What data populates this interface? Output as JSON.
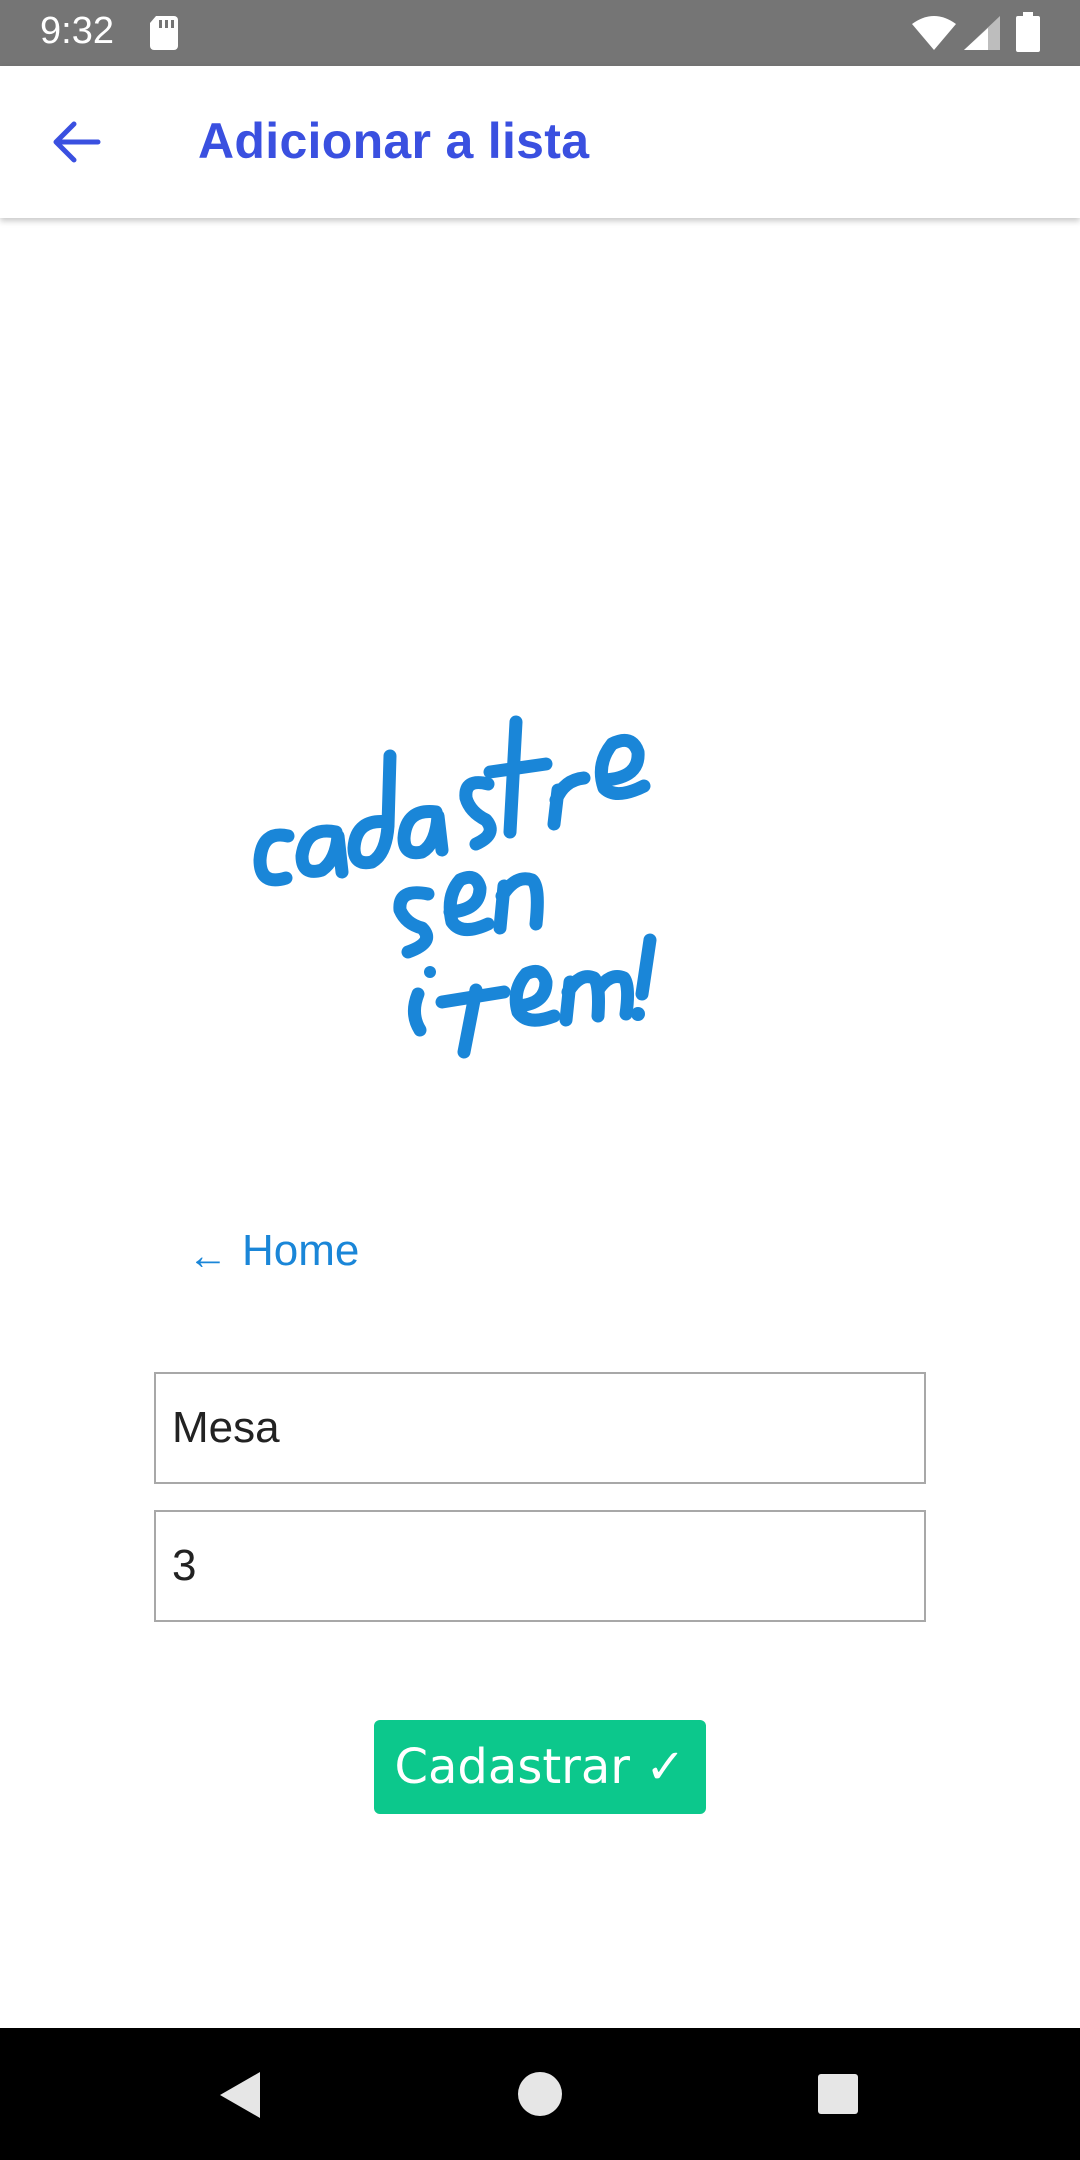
{
  "status_bar": {
    "time": "9:32",
    "icons": [
      "sd-card-icon",
      "wifi-icon",
      "signal-icon",
      "battery-icon"
    ]
  },
  "app_bar": {
    "title": "Adicionar a lista",
    "back_icon": "arrow-left-icon"
  },
  "hero": {
    "lettering": "cadastre seu item!",
    "color": "#1a86d8"
  },
  "home_link": {
    "arrow": "←",
    "label": "Home"
  },
  "form": {
    "name_value": "Mesa",
    "quantity_value": "3",
    "submit_label": "Cadastrar ✓"
  },
  "nav_bar": {
    "icons": [
      "back-triangle-icon",
      "home-circle-icon",
      "recents-square-icon"
    ]
  },
  "colors": {
    "accent": "#3a50e0",
    "link": "#1a86d8",
    "button": "#0cc88c",
    "status_bar": "#757575",
    "nav_bar": "#000000"
  }
}
